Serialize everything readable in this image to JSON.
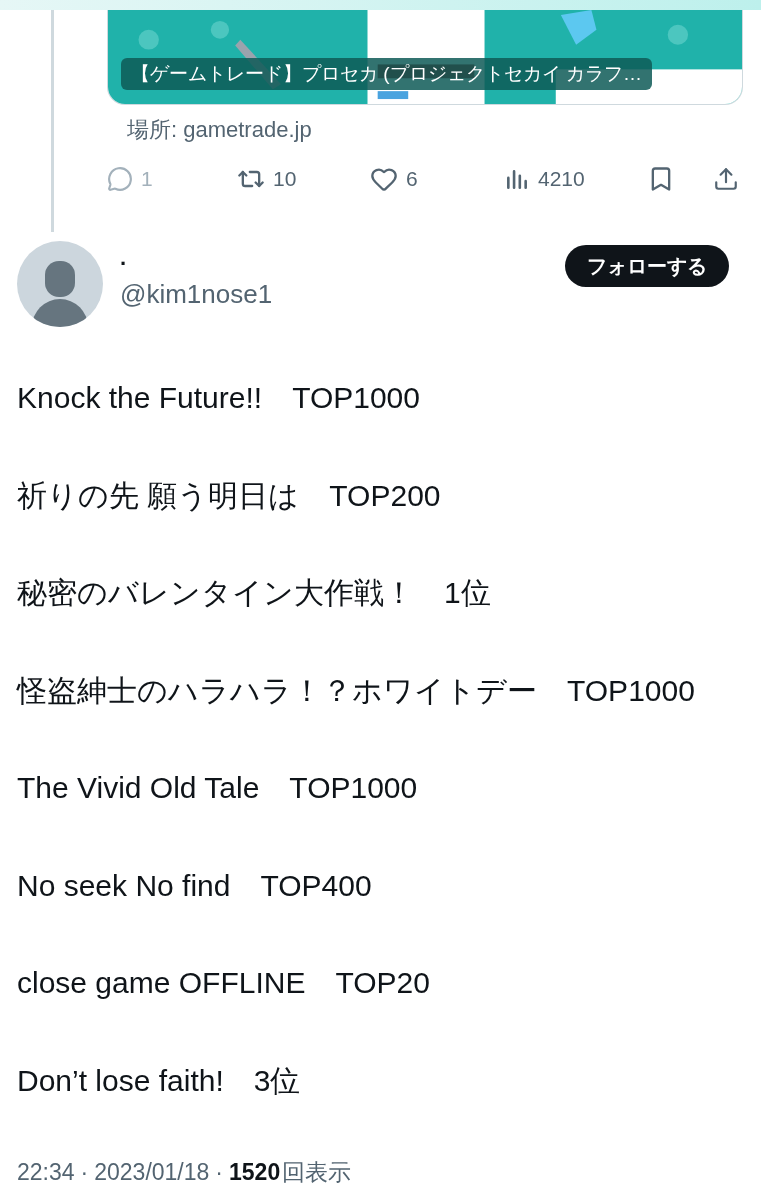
{
  "link_card": {
    "kind": "picture",
    "title": "【ゲームトレード】プロセカ (プロジェクトセカイ カラフ…",
    "domain": "場所: gametrade.jp"
  },
  "actions": [
    {
      "kind": "reply",
      "count": "1",
      "disabled": true
    },
    {
      "kind": "retweet",
      "count": "10",
      "disabled": false
    },
    {
      "kind": "like",
      "count": "6",
      "disabled": false
    },
    {
      "kind": "views",
      "count": "4210",
      "disabled": false
    },
    {
      "kind": "bookmark",
      "disabled": false
    },
    {
      "kind": "share",
      "disabled": false
    }
  ],
  "author": {
    "name": "·",
    "handle": "@kim1nose1",
    "follow_button": "フォローする"
  },
  "body_lines": [
    "Knock the Future!!　TOP1000",
    "祈りの先 願う明日は　TOP200",
    "秘密のバレンタイン大作戦！　1位",
    "怪盗紳士のハラハラ！？ホワイトデー　TOP1000",
    "The Vivid Old Tale　TOP1000",
    "No seek No find　TOP400",
    "close game OFFLINE　TOP20",
    "Don’t lose faith!　3位"
  ],
  "footer": {
    "time": "22:34",
    "separator": "·",
    "date": "2023/01/18",
    "views": "1520",
    "views_label": "回表示"
  }
}
